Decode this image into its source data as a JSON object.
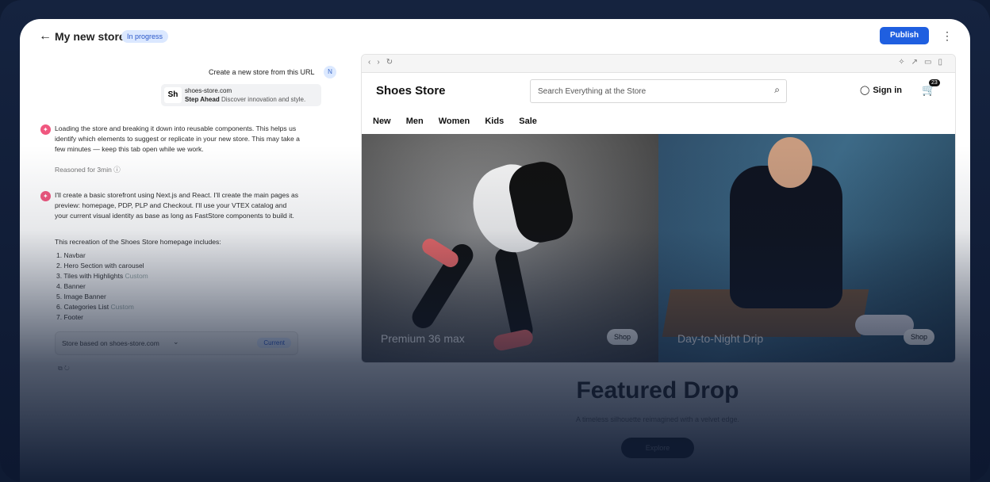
{
  "header": {
    "back_icon": "arrow-left-icon",
    "title": "My new store",
    "status": "In progress",
    "publish": "Publish",
    "menu_icon": "more-vertical-icon"
  },
  "chat": {
    "user_message": "Create a new store from this URL",
    "user_avatar": "N",
    "url_card": {
      "badge": "Sh",
      "domain": "shoes-store.com",
      "tagline_strong": "Step Ahead",
      "tagline": "Discover innovation and style."
    },
    "msg1": "Loading the store and breaking it down into reusable components. This helps us identify which elements to suggest or replicate in your new store. This may take a few minutes — keep this tab open while we work.",
    "reasoned": "Reasoned for 3min",
    "msg2": "I'll create a basic storefront using Next.js and React. I'll create the main pages as preview: homepage, PDP, PLP and Checkout. I'll use your VTEX catalog and your current visual identity as base as long as FastStore components to build it.",
    "list_intro": "This recreation of the Shoes Store homepage includes:",
    "list": [
      {
        "label": "1. Navbar",
        "tag": ""
      },
      {
        "label": "2. Hero Section with carousel",
        "tag": ""
      },
      {
        "label": "3. Tiles with Highlights",
        "tag": "Custom"
      },
      {
        "label": "4. Banner",
        "tag": ""
      },
      {
        "label": "5. Image Banner",
        "tag": ""
      },
      {
        "label": "6. Categories List",
        "tag": "Custom"
      },
      {
        "label": "7. Footer",
        "tag": ""
      }
    ],
    "selector": {
      "label": "Store based on shoes-store.com",
      "badge": "Current"
    }
  },
  "preview": {
    "brand": "Shoes Store",
    "search_placeholder": "Search Everything at the Store",
    "signin": "Sign in",
    "cart_count": "23",
    "menu": [
      "New",
      "Men",
      "Women",
      "Kids",
      "Sale"
    ],
    "heroes": [
      {
        "label": "Premium 36 max",
        "shop": "Shop"
      },
      {
        "label": "Day-to-Night Drip",
        "shop": "Shop"
      }
    ],
    "featured": {
      "title": "Featured Drop",
      "subtitle": "A timeless silhouette reimagined with a velvet edge.",
      "button": "Explore"
    }
  }
}
